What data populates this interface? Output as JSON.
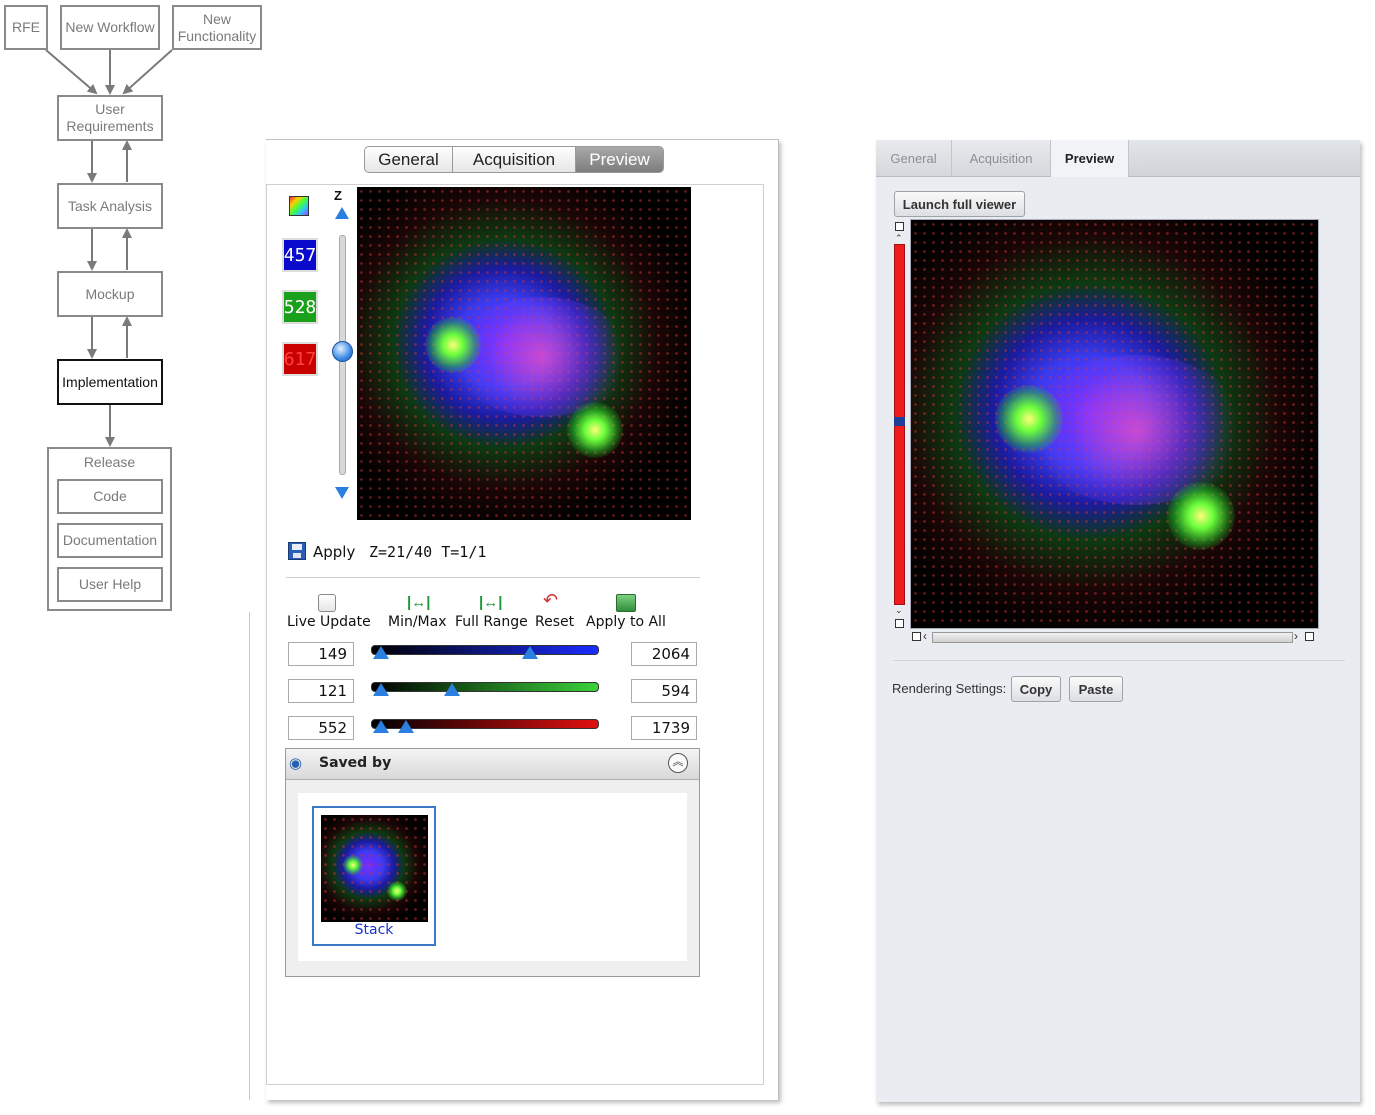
{
  "flowchart": {
    "rfe": "RFE",
    "new_workflow": "New Workflow",
    "new_functionality": "New Functionality",
    "user_requirements": "User Requirements",
    "task_analysis": "Task Analysis",
    "mockup": "Mockup",
    "implementation": "Implementation",
    "release": "Release",
    "code": "Code",
    "documentation": "Documentation",
    "user_help": "User Help"
  },
  "left_mockup": {
    "tabs": [
      "General",
      "Acquisition",
      "Preview"
    ],
    "selected_tab": "Preview",
    "z_label": "Z",
    "channels": [
      {
        "label": "457",
        "color": "#0a0acc"
      },
      {
        "label": "528",
        "color": "#1aa01a"
      },
      {
        "label": "617",
        "color": "#c80000"
      }
    ],
    "apply_label": "Apply",
    "position_text": "Z=21/40 T=1/1",
    "live_update_label": "Live Update",
    "toolbar": {
      "min_max": "Min/Max",
      "full_range": "Full Range",
      "reset": "Reset",
      "apply_to_all": "Apply to All"
    },
    "ranges": [
      {
        "min": "149",
        "max": "2064",
        "color": "#1a2cff"
      },
      {
        "min": "121",
        "max": "594",
        "color": "#3ad23a"
      },
      {
        "min": "552",
        "max": "1739",
        "color": "#e01010"
      }
    ],
    "saved_by_title": "Saved by",
    "thumbnail_label": "Stack"
  },
  "right_mockup": {
    "tabs": [
      "General",
      "Acquisition",
      "Preview"
    ],
    "selected_tab": "Preview",
    "launch_button": "Launch full viewer",
    "rendering_label": "Rendering Settings:",
    "copy_button": "Copy",
    "paste_button": "Paste"
  }
}
